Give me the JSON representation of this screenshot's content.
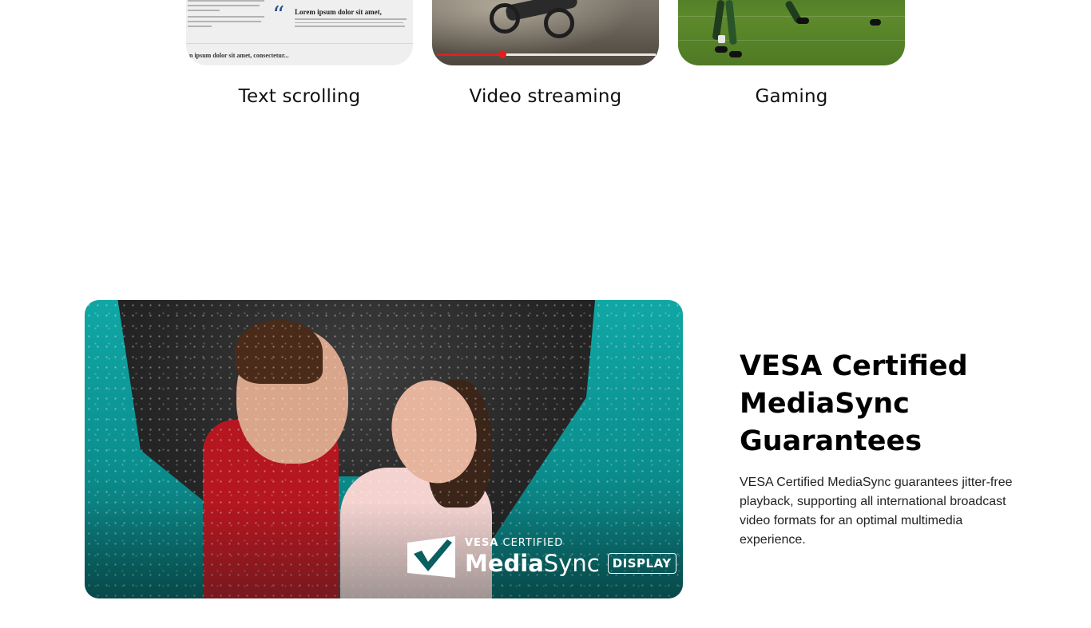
{
  "use_cases": {
    "items": [
      {
        "label": "Text scrolling"
      },
      {
        "label": "Video streaming"
      },
      {
        "label": "Gaming"
      }
    ],
    "text_mock": {
      "headline": "Lorem ipsum dolor sit amet,",
      "footer": "n ipsum dolor sit amet, consectetur..."
    },
    "video_mock": {
      "progress_fraction": 0.3
    }
  },
  "feature": {
    "title": "VESA Certified MediaSync Guarantees",
    "description": "VESA Certified MediaSync guarantees jitter-free playback, supporting all international broadcast video formats for an optimal multimedia experience.",
    "logo": {
      "line1_bold": "VESA",
      "line1_light": "CERTIFIED",
      "name_bold": "Media",
      "name_light": "Sync",
      "badge": "DISPLAY"
    }
  },
  "colors": {
    "accent_red": "#e02020",
    "teal": "#0f9e9c",
    "quote_blue": "#2b4e8c"
  }
}
